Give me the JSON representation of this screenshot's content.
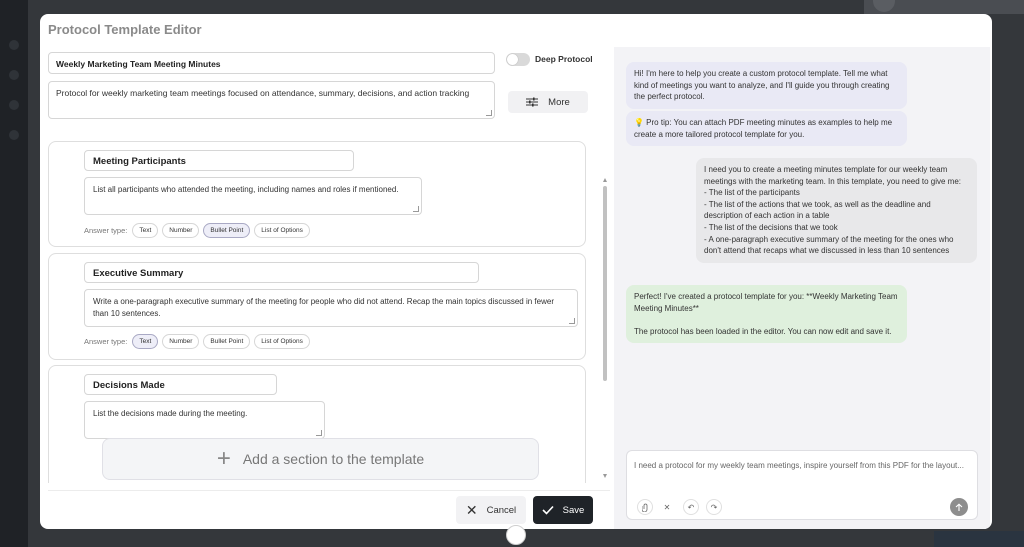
{
  "modal": {
    "title": "Protocol Template Editor"
  },
  "template": {
    "name": "Weekly Marketing Team Meeting Minutes",
    "description": "Protocol for weekly marketing team meetings focused on attendance, summary, decisions, and action tracking"
  },
  "deep_protocol": {
    "label": "Deep Protocol",
    "enabled": false
  },
  "more_button": {
    "label": "More",
    "icon": "sliders-icon"
  },
  "answer_type_label": "Answer type:",
  "answer_types": [
    "Text",
    "Number",
    "Bullet Point",
    "List of Options"
  ],
  "sections": [
    {
      "title": "Meeting Participants",
      "instructions": "List all participants who attended the meeting, including names and roles if mentioned.",
      "selected": "Bullet Point"
    },
    {
      "title": "Executive Summary",
      "instructions": "Write a one-paragraph executive summary of the meeting for people who did not attend. Recap the main topics discussed in fewer than 10 sentences.",
      "selected": "Text"
    },
    {
      "title": "Decisions Made",
      "instructions": "List the decisions made during the meeting.",
      "selected": ""
    }
  ],
  "add_section": {
    "label": "Add a section to the template"
  },
  "footer": {
    "cancel_label": "Cancel",
    "save_label": "Save"
  },
  "chat": {
    "messages": [
      {
        "role": "assistant",
        "text": "Hi! I'm here to help you create a custom protocol template. Tell me what kind of meetings you want to analyze, and I'll guide you through creating the perfect protocol."
      },
      {
        "role": "assistant",
        "text": "💡 Pro tip: You can attach PDF meeting minutes as examples to help me create a more tailored protocol template for you."
      },
      {
        "role": "user",
        "text": "I need you to create a meeting minutes template for our weekly team meetings with the marketing team. In this template, you need to give me:\n- The list of the participants\n- The list of the actions that we took, as well as the deadline and description of each action in a table\n- The list of the decisions that we took\n- A one-paragraph executive summary of the meeting for the ones who don't attend that recaps what we discussed in less than 10 sentences"
      },
      {
        "role": "assistant",
        "text": "Perfect! I've created a protocol template for you: **Weekly Marketing Team Meeting Minutes**\n\nThe protocol has been loaded in the editor. You can now edit and save it."
      }
    ],
    "input_value": "I need a protocol for my weekly team meetings, inspire yourself from this PDF for the layout...",
    "tools": [
      "attach-icon",
      "clear-icon",
      "undo-icon",
      "redo-icon",
      "send-icon"
    ]
  }
}
